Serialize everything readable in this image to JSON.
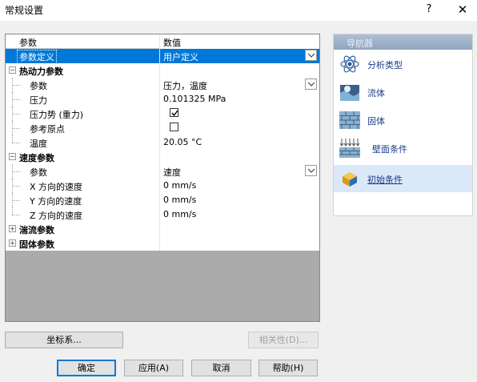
{
  "window": {
    "title": "常规设置",
    "help": "?",
    "close": "✕"
  },
  "grid": {
    "header": {
      "name": "参数",
      "value": "数值"
    },
    "rows": [
      {
        "name": "参数定义",
        "value": "用户定义"
      },
      {
        "name": "热动力参数"
      },
      {
        "name": "参数",
        "value": "压力，温度"
      },
      {
        "name": "压力",
        "value": "0.101325 MPa"
      },
      {
        "name": "压力势 (重力)",
        "checked": true
      },
      {
        "name": "参考原点",
        "checked": false
      },
      {
        "name": "温度",
        "value": "20.05 °C"
      },
      {
        "name": "速度参数"
      },
      {
        "name": "参数",
        "value": "速度"
      },
      {
        "name": "X 方向的速度",
        "value": "0 mm/s"
      },
      {
        "name": "Y 方向的速度",
        "value": "0 mm/s"
      },
      {
        "name": "Z 方向的速度",
        "value": "0 mm/s"
      },
      {
        "name": "湍流参数"
      },
      {
        "name": "固体参数"
      }
    ]
  },
  "navigator": {
    "title": "导航器",
    "items": [
      {
        "label": "分析类型",
        "icon": "analysis-type-icon"
      },
      {
        "label": "流体",
        "icon": "fluid-icon"
      },
      {
        "label": "固体",
        "icon": "solid-icon"
      },
      {
        "label": "壁面条件",
        "icon": "wall-condition-icon"
      },
      {
        "label": "初始条件",
        "icon": "initial-condition-icon"
      }
    ]
  },
  "buttons": {
    "coord": "坐标系...",
    "dependency": "相关性(D)...",
    "ok": "确定",
    "apply": "应用(A)",
    "cancel": "取消",
    "help": "帮助(H)"
  },
  "colors": {
    "selection": "#0078d7",
    "nav_header": "#9fb3cb",
    "link": "#1a3c8c"
  }
}
